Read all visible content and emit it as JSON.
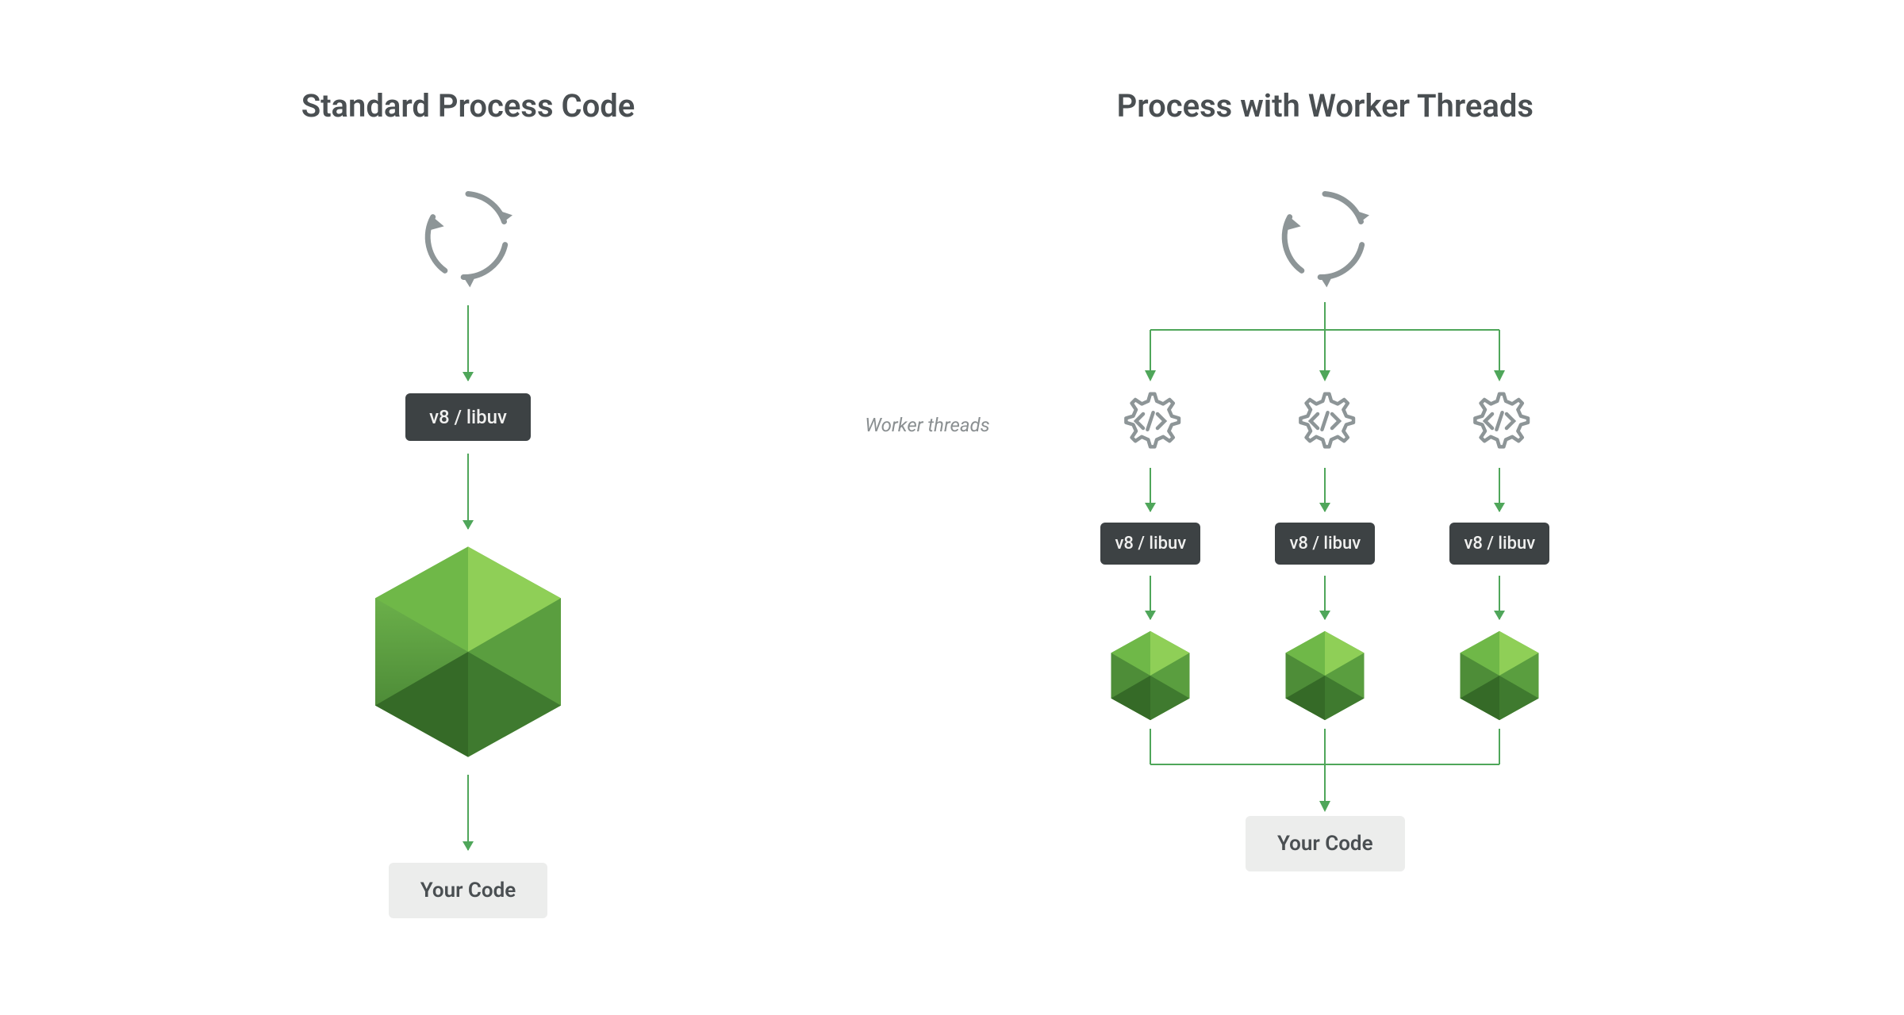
{
  "left": {
    "title": "Standard Process Code",
    "v8_label": "v8 / libuv",
    "your_code": "Your Code"
  },
  "right": {
    "title": "Process with Worker Threads",
    "worker_threads_label": "Worker threads",
    "branches": [
      {
        "v8_label": "v8 / libuv"
      },
      {
        "v8_label": "v8 / libuv"
      },
      {
        "v8_label": "v8 / libuv"
      }
    ],
    "your_code": "Your Code"
  },
  "colors": {
    "arrow": "#4fa65a",
    "chip_bg": "#3d4244",
    "text_muted": "#8a8f91",
    "heading": "#4a4f52",
    "code_bg": "#ecedec",
    "icon_stroke": "#8d9597"
  }
}
